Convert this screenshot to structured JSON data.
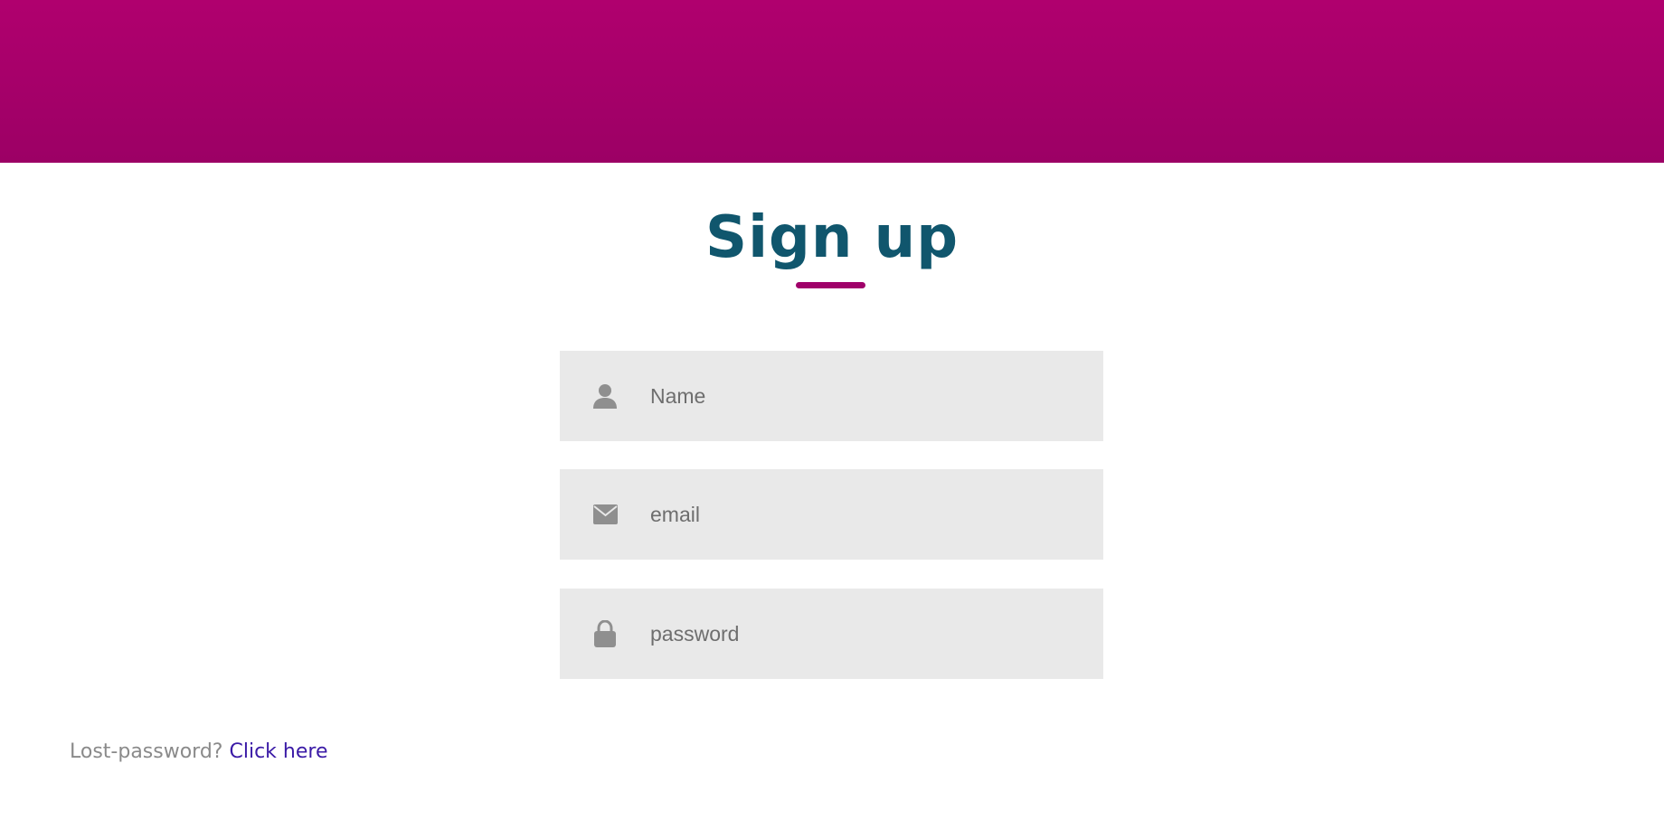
{
  "header": {
    "banner_color": "#a6006a"
  },
  "title": {
    "text": "Sign up",
    "color": "#10566d",
    "underline_color": "#a0006a"
  },
  "form": {
    "fields": [
      {
        "icon": "user-icon",
        "placeholder": "Name",
        "value": ""
      },
      {
        "icon": "envelope-icon",
        "placeholder": "email",
        "value": ""
      },
      {
        "icon": "lock-icon",
        "placeholder": "password",
        "value": ""
      }
    ],
    "field_background": "#e9e9e9"
  },
  "footer": {
    "prompt": "Lost-password?",
    "link_text": "Click here",
    "link_color": "#3a1aa6"
  }
}
